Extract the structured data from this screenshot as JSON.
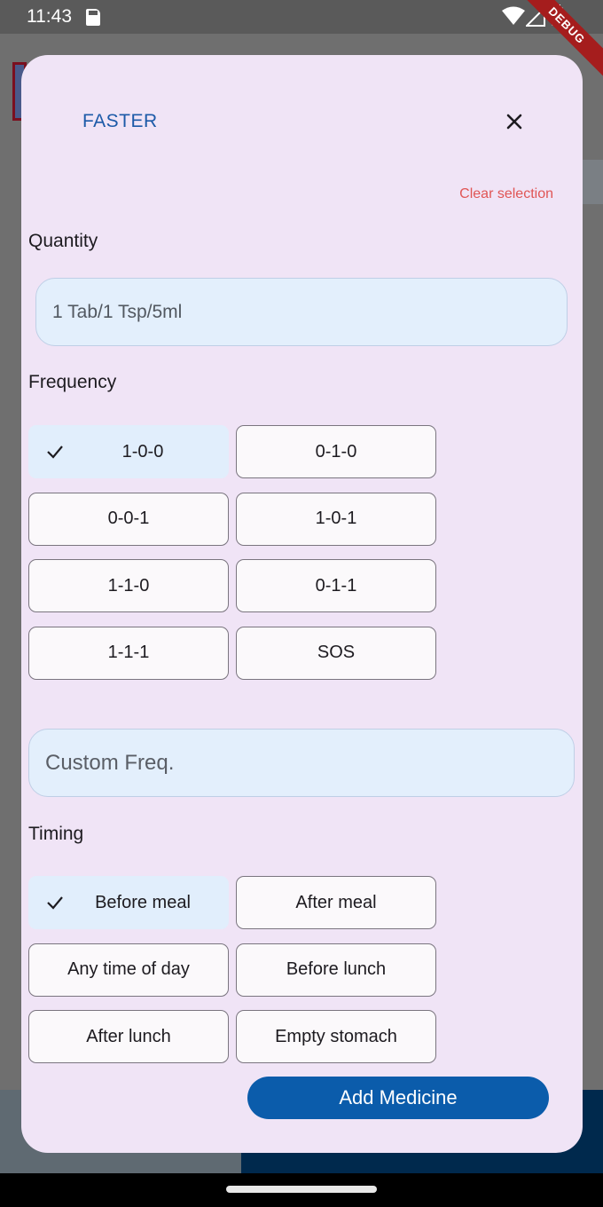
{
  "status_bar": {
    "time": "11:43",
    "debug_label": "DEBUG"
  },
  "dialog": {
    "title": "FASTER",
    "close_icon": "close-icon",
    "clear_selection": "Clear selection",
    "quantity": {
      "label": "Quantity",
      "value": "1 Tab/1 Tsp/5ml"
    },
    "frequency": {
      "label": "Frequency",
      "options": [
        "1-0-0",
        "0-1-0",
        "0-0-1",
        "1-0-1",
        "1-1-0",
        "0-1-1",
        "1-1-1",
        "SOS"
      ],
      "selected": "1-0-0",
      "custom_placeholder": "Custom Freq."
    },
    "timing": {
      "label": "Timing",
      "options": [
        "Before meal",
        "After meal",
        "Any time of day",
        "Before lunch",
        "After lunch",
        "Empty stomach"
      ],
      "selected": "Before meal"
    },
    "add_button": "Add Medicine"
  },
  "colors": {
    "accent": "#0b5cab",
    "dialog_bg": "#f0e4f6",
    "selected_chip": "#e1eefc",
    "clear_link": "#e05555",
    "title": "#1c5aa8"
  }
}
